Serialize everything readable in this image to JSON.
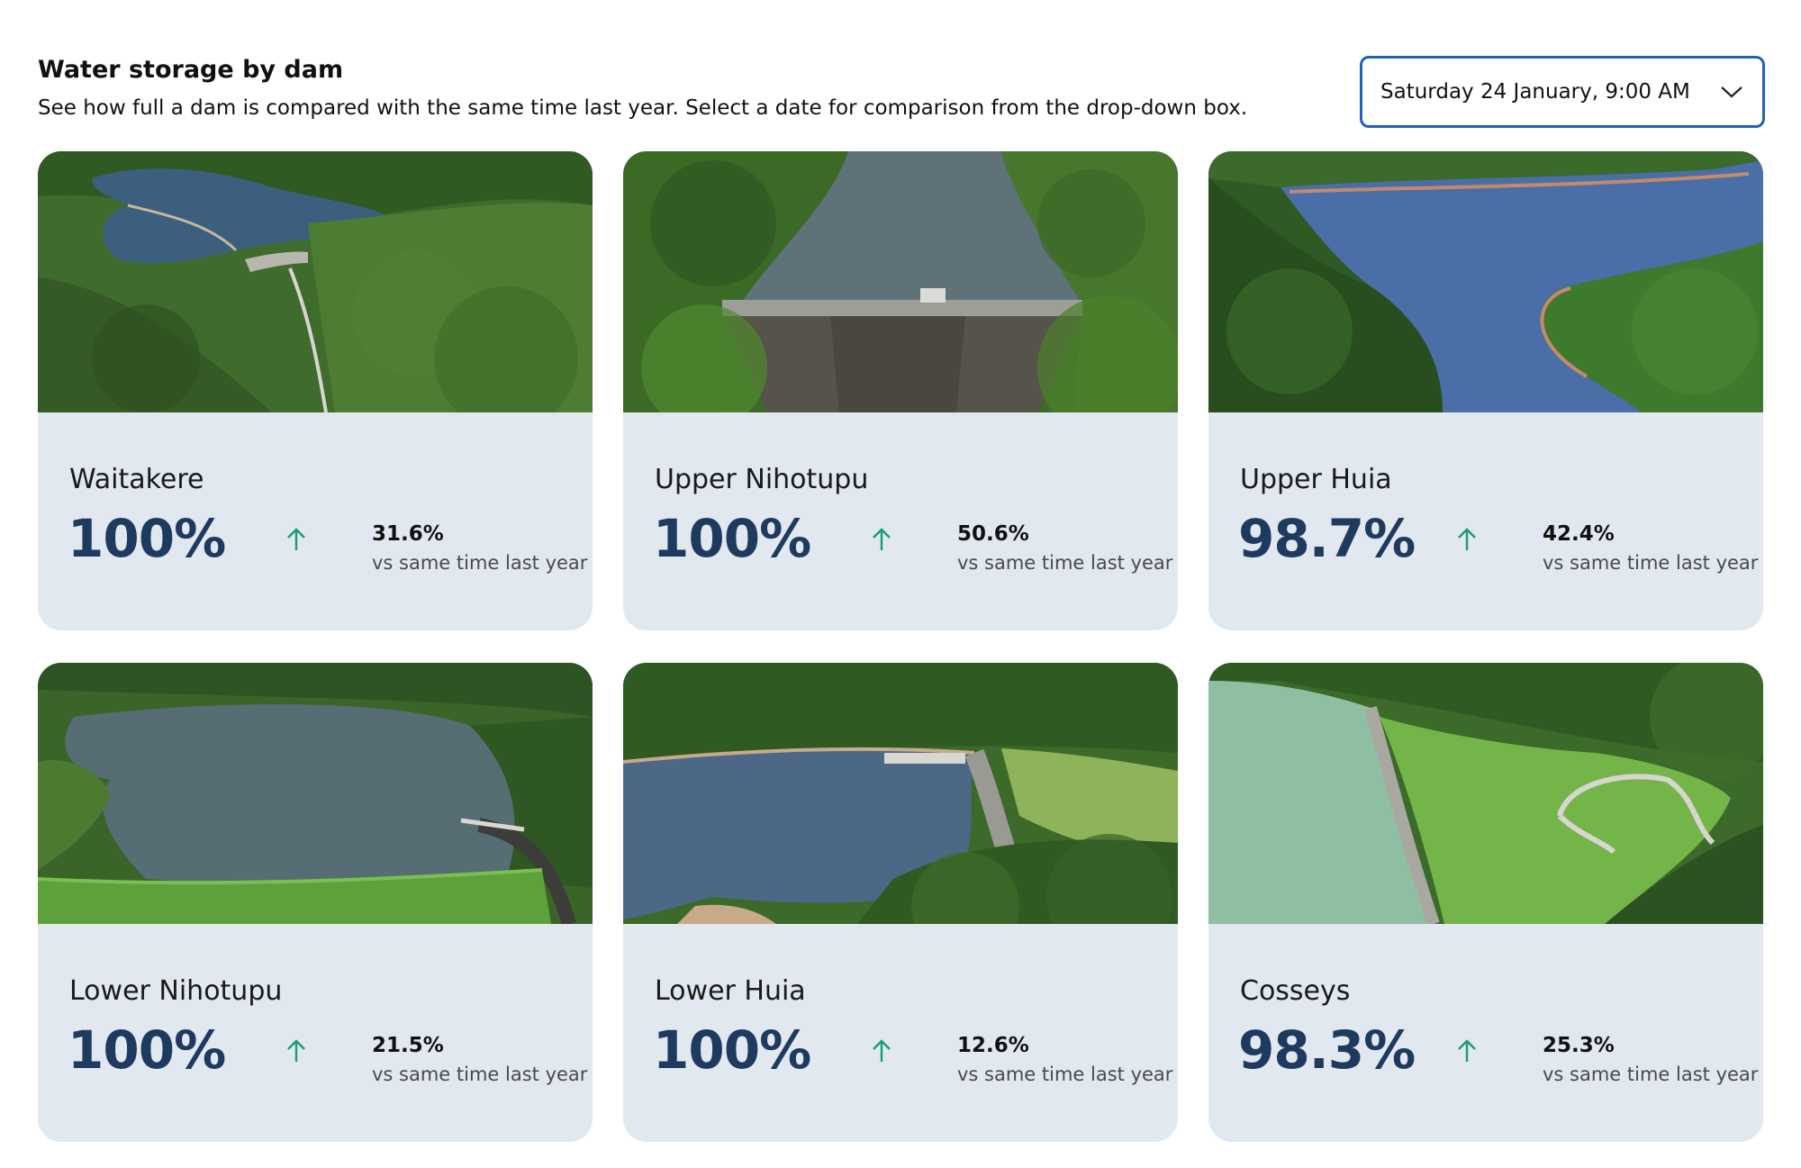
{
  "header": {
    "title": "Water storage by dam",
    "subtitle": "See how full a dam is compared with the same time last year. Select a date for comparison from the drop-down box."
  },
  "date_select": {
    "value": "Saturday 24 January, 9:00 AM"
  },
  "colors": {
    "card_bg": "#e2e8f0",
    "percent": "#1e3a5f",
    "arrow_up": "#1a9a7a",
    "select_border": "#1e64b4"
  },
  "dams": [
    {
      "name": "Waitakere",
      "percent": "100%",
      "change": "31.6%",
      "change_label": "vs same time last year",
      "trend": "arrow-up-icon"
    },
    {
      "name": "Upper Nihotupu",
      "percent": "100%",
      "change": "50.6%",
      "change_label": "vs same time last year",
      "trend": "arrow-up-icon"
    },
    {
      "name": "Upper Huia",
      "percent": "98.7%",
      "change": "42.4%",
      "change_label": "vs same time last year",
      "trend": "arrow-up-icon"
    },
    {
      "name": "Lower Nihotupu",
      "percent": "100%",
      "change": "21.5%",
      "change_label": "vs same time last year",
      "trend": "arrow-up-icon"
    },
    {
      "name": "Lower Huia",
      "percent": "100%",
      "change": "12.6%",
      "change_label": "vs same time last year",
      "trend": "arrow-up-icon"
    },
    {
      "name": "Cosseys",
      "percent": "98.3%",
      "change": "25.3%",
      "change_label": "vs same time last year",
      "trend": "arrow-up-icon"
    }
  ]
}
